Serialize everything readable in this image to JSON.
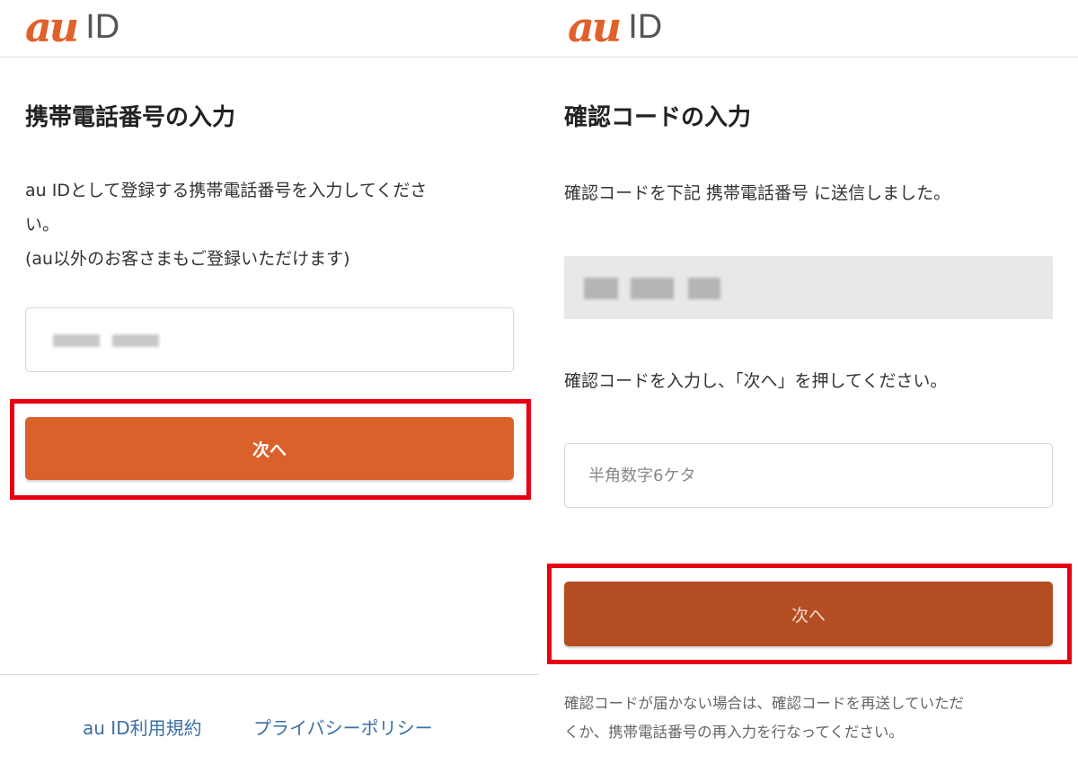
{
  "left_screen": {
    "logo": {
      "brand": "au",
      "id_text": "ID"
    },
    "title": "携帯電話番号の入力",
    "description": {
      "line1": "au IDとして登録する携帯電話番号を入力してくださ",
      "line2": "い。",
      "line3": "(au以外のお客さまもご登録いただけます)"
    },
    "phone_input": {
      "value": "",
      "placeholder": ""
    },
    "next_button": "次へ",
    "footer": {
      "terms_link": "au ID利用規約",
      "privacy_link": "プライバシーポリシー"
    }
  },
  "right_screen": {
    "logo": {
      "brand": "au",
      "id_text": "ID"
    },
    "title": "確認コードの入力",
    "sent_message": "確認コードを下記 携帯電話番号 に送信しました。",
    "instruction": "確認コードを入力し、「次へ」を押してください。",
    "code_input": {
      "value": "",
      "placeholder": "半角数字6ケタ"
    },
    "next_button": "次へ",
    "note": {
      "line1": "確認コードが届かない場合は、確認コードを再送していただ",
      "line2": "くか、携帯電話番号の再入力を行なってください。"
    }
  },
  "colors": {
    "brand_orange": "#e0612a",
    "button_left": "#da612a",
    "button_right": "#b44e22",
    "highlight_red": "#e60012",
    "link_blue": "#3a6ea5"
  }
}
